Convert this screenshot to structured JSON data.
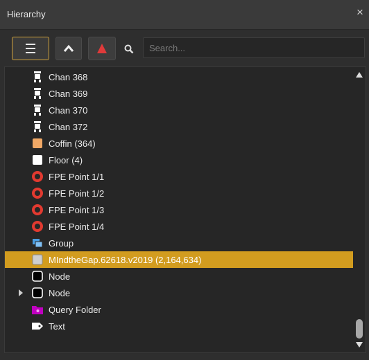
{
  "panel": {
    "title": "Hierarchy",
    "close_label": "×"
  },
  "toolbar": {
    "search_placeholder": "Search...",
    "search_value": "",
    "accent_color": "#d4a43a",
    "warning_color": "#e03a3a"
  },
  "tree": {
    "items": [
      {
        "label": "Chan 368",
        "icon": "channel-icon",
        "selected": false,
        "expandable": false
      },
      {
        "label": "Chan 369",
        "icon": "channel-icon",
        "selected": false,
        "expandable": false
      },
      {
        "label": "Chan 370",
        "icon": "channel-icon",
        "selected": false,
        "expandable": false
      },
      {
        "label": "Chan 372",
        "icon": "channel-icon",
        "selected": false,
        "expandable": false
      },
      {
        "label": "Coffin (364)",
        "icon": "coffin-swatch-icon",
        "color": "#f0a866",
        "selected": false,
        "expandable": false
      },
      {
        "label": "Floor (4)",
        "icon": "floor-swatch-icon",
        "color": "#ffffff",
        "selected": false,
        "expandable": false
      },
      {
        "label": "FPE Point 1/1",
        "icon": "fpe-point-icon",
        "selected": false,
        "expandable": false
      },
      {
        "label": "FPE Point 1/2",
        "icon": "fpe-point-icon",
        "selected": false,
        "expandable": false
      },
      {
        "label": "FPE Point 1/3",
        "icon": "fpe-point-icon",
        "selected": false,
        "expandable": false
      },
      {
        "label": "FPE Point 1/4",
        "icon": "fpe-point-icon",
        "selected": false,
        "expandable": false
      },
      {
        "label": "Group",
        "icon": "group-icon",
        "selected": false,
        "expandable": false
      },
      {
        "label": "MIndtheGap.62618.v2019 (2,164,634)",
        "icon": "model-swatch-icon",
        "color": "#cfcfcf",
        "selected": true,
        "expandable": false
      },
      {
        "label": "Node",
        "icon": "node-icon",
        "selected": false,
        "expandable": false
      },
      {
        "label": "Node",
        "icon": "node-icon",
        "selected": false,
        "expandable": true
      },
      {
        "label": "Query Folder",
        "icon": "query-folder-icon",
        "color": "#c000c0",
        "selected": false,
        "expandable": false
      },
      {
        "label": "Text",
        "icon": "text-tag-icon",
        "selected": false,
        "expandable": false
      }
    ],
    "selection_color": "#d29c1f"
  }
}
